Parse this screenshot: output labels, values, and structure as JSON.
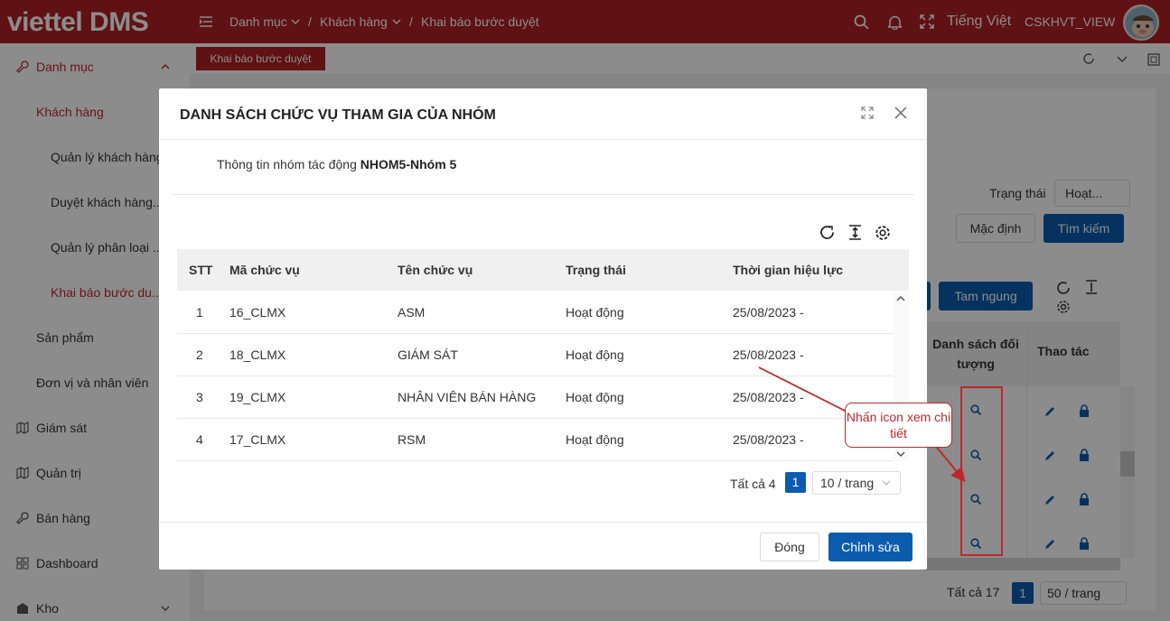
{
  "header": {
    "logo": "viettel DMS",
    "breadcrumb": [
      "Danh mục",
      "Khách hàng",
      "Khai báo bước duyệt"
    ],
    "separator": "/",
    "language": "Tiếng Việt",
    "username": "CSKHVT_VIEW"
  },
  "sidebar": {
    "items": [
      {
        "label": "Danh mục"
      },
      {
        "label": "Khách hàng"
      },
      {
        "label": "Quản lý khách hàng"
      },
      {
        "label": "Duyệt khách hàng..."
      },
      {
        "label": "Quản lý phân loại ..."
      },
      {
        "label": "Khai báo bước du..."
      },
      {
        "label": "Sản phẩm"
      },
      {
        "label": "Đơn vị và nhân viên"
      },
      {
        "label": "Giám sát"
      },
      {
        "label": "Quản trị"
      },
      {
        "label": "Bán hàng"
      },
      {
        "label": "Dashboard"
      },
      {
        "label": "Kho"
      }
    ]
  },
  "page": {
    "tab_label": "Khai báo bước duyệt",
    "filter_status_label": "Trạng thái",
    "filter_status_value": "Hoạt...",
    "default_button": "Mặc định",
    "search_button": "Tìm kiếm",
    "pause_button": "Tam ngung",
    "col_object_list": "Danh sách đối tượng",
    "col_actions": "Thao tác",
    "total_text": "Tất cả 17",
    "current_page": "1",
    "page_size": "50 / trang"
  },
  "modal": {
    "title": "DANH SÁCH CHỨC VỤ THAM GIA CỦA NHÓM",
    "group_info_label": "Thông tin nhóm tác động",
    "group_info_value": "NHOM5-Nhóm 5",
    "columns": {
      "stt": "STT",
      "code": "Mã chức vụ",
      "name": "Tên chức vụ",
      "status": "Trạng thái",
      "effective": "Thời gian hiệu lực"
    },
    "rows": [
      {
        "stt": "1",
        "code": "16_CLMX",
        "name": "ASM",
        "status": "Hoạt động",
        "effective": "25/08/2023 -"
      },
      {
        "stt": "2",
        "code": "18_CLMX",
        "name": "GIÁM SÁT",
        "status": "Hoạt động",
        "effective": "25/08/2023 -"
      },
      {
        "stt": "3",
        "code": "19_CLMX",
        "name": "NHÂN VIÊN BÁN HÀNG",
        "status": "Hoạt động",
        "effective": "25/08/2023 -"
      },
      {
        "stt": "4",
        "code": "17_CLMX",
        "name": "RSM",
        "status": "Hoạt động",
        "effective": "25/08/2023 -"
      }
    ],
    "pagination": {
      "total_text": "Tất cả 4",
      "current_page": "1",
      "page_size": "10 / trang"
    },
    "close_button": "Đóng",
    "edit_button": "Chỉnh sửa"
  },
  "annotation": {
    "text": "Nhấn icon xem chi tiết",
    "color": "#c0272d"
  },
  "colors": {
    "brand_red": "#b01f24",
    "primary_blue": "#0b5cad"
  }
}
